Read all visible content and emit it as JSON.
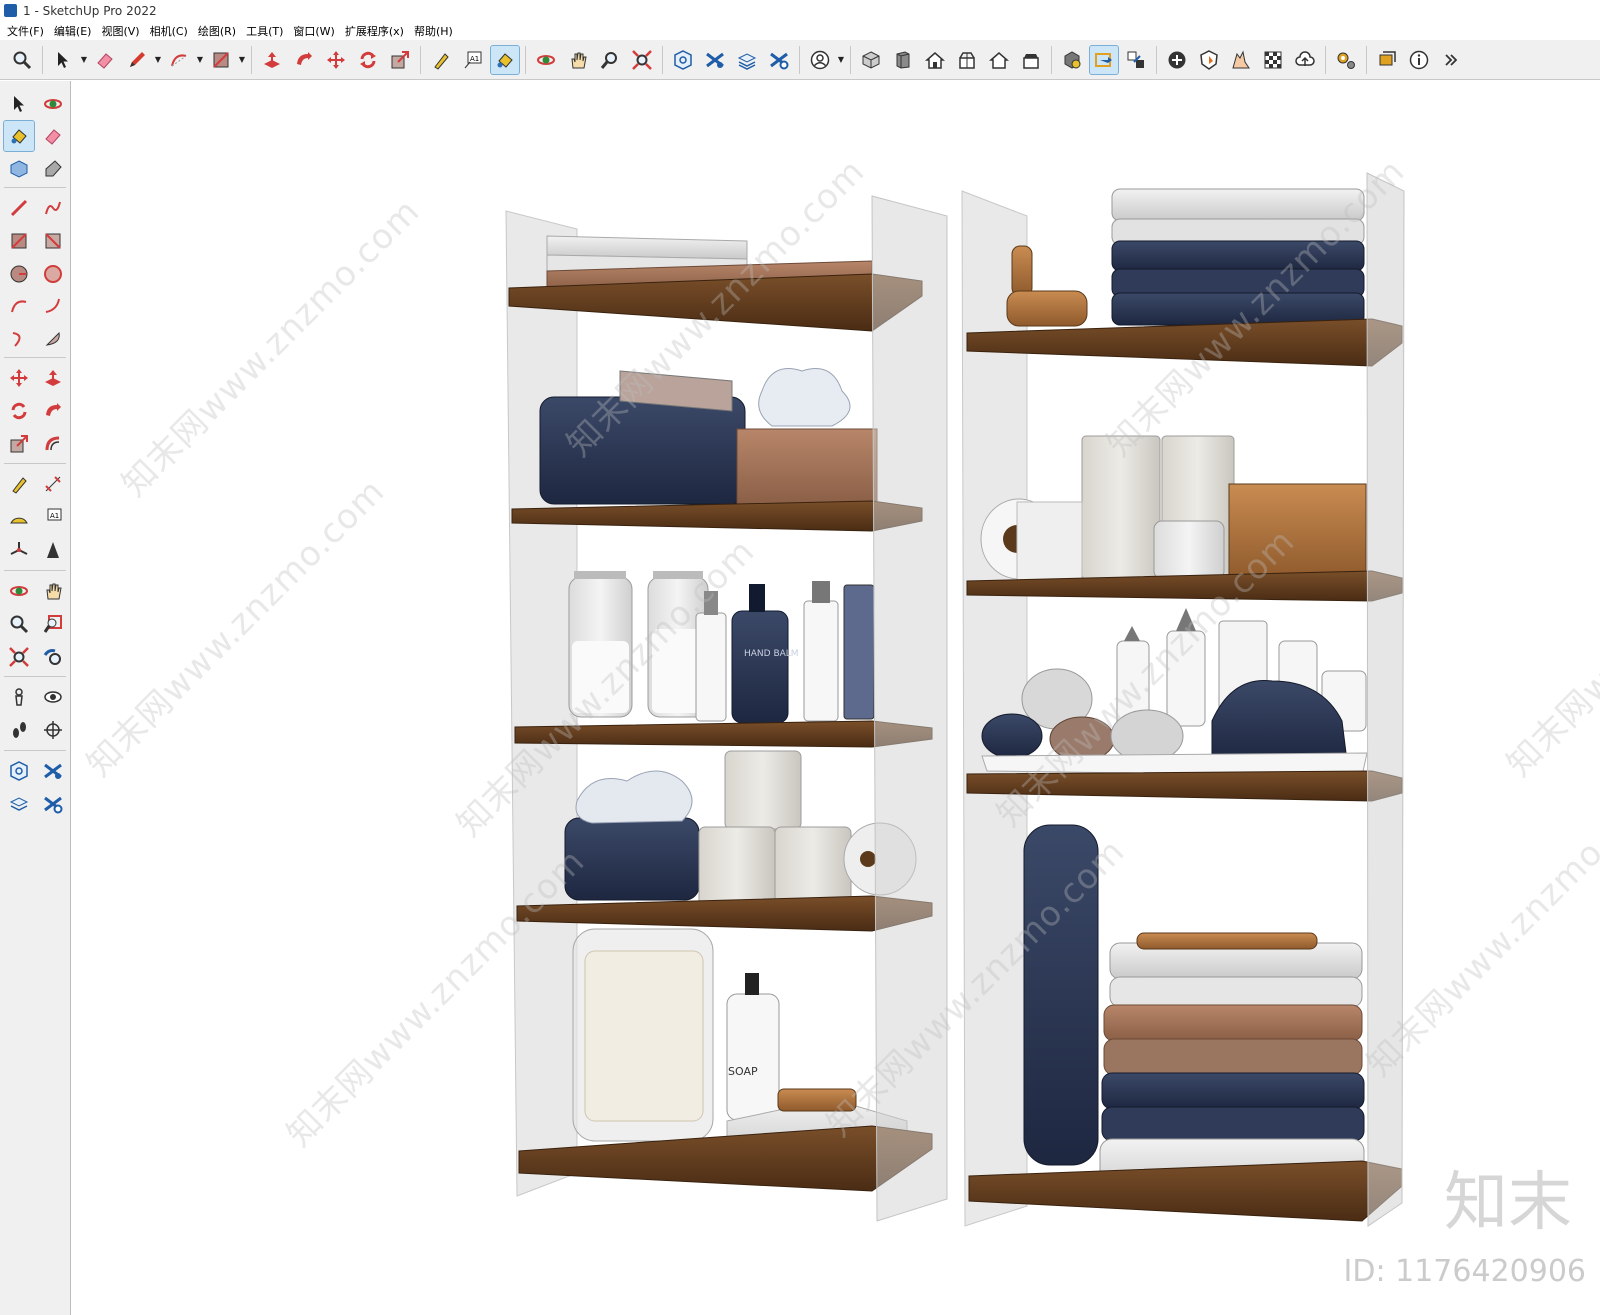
{
  "window": {
    "title": "1 - SketchUp Pro 2022"
  },
  "menu": [
    "文件(F)",
    "编辑(E)",
    "视图(V)",
    "相机(C)",
    "绘图(R)",
    "工具(T)",
    "窗口(W)",
    "扩展程序(x)",
    "帮助(H)"
  ],
  "toolbar": {
    "icons": [
      "zoom-icon",
      "select-icon",
      "eraser-icon",
      "pencil-icon",
      "arc-icon",
      "rectangle-icon",
      "push-pull-icon",
      "follow-me-icon",
      "move-icon",
      "rotate-icon",
      "scale-icon",
      "tape-measure-icon",
      "text-icon",
      "paint-bucket-icon",
      "orbit-icon",
      "pan-icon",
      "zoom-window-icon",
      "zoom-extents-icon",
      "3d-warehouse-icon",
      "extension-warehouse-icon",
      "layout-icon",
      "extension-manager-icon",
      "user-icon",
      "iso-view-icon",
      "top-view-icon",
      "front-view-icon",
      "right-view-icon",
      "back-view-icon",
      "left-view-icon",
      "solid-tools-icon",
      "outer-shell-icon",
      "intersect-icon",
      "add-location-icon",
      "shadows-icon",
      "sandbox-icon",
      "terrain-icon",
      "cloud-icon",
      "extensions-icon",
      "section-icon",
      "info-icon",
      "more-icon"
    ]
  },
  "leftbar": {
    "rows": [
      [
        "select-icon",
        "orbit-icon"
      ],
      [
        "paint-bucket-icon",
        "eraser-icon"
      ],
      [
        "component-icon",
        "tag-icon"
      ],
      [
        "line-icon",
        "freehand-icon"
      ],
      [
        "rectangle-icon",
        "rotated-rectangle-icon"
      ],
      [
        "circle-icon",
        "polygon-icon"
      ],
      [
        "arc-icon",
        "two-point-arc-icon"
      ],
      [
        "three-point-arc-icon",
        "pie-icon"
      ],
      [
        "move-icon",
        "push-pull-icon"
      ],
      [
        "rotate-icon",
        "follow-me-icon"
      ],
      [
        "scale-icon",
        "offset-icon"
      ],
      [
        "tape-measure-icon",
        "dimension-icon"
      ],
      [
        "protractor-icon",
        "text-icon"
      ],
      [
        "axes-icon",
        "3d-text-icon"
      ],
      [
        "orbit-icon",
        "pan-icon"
      ],
      [
        "zoom-icon",
        "zoom-window-icon"
      ],
      [
        "zoom-extents-icon",
        "previous-view-icon"
      ],
      [
        "position-camera-icon",
        "look-around-icon"
      ],
      [
        "walk-icon",
        "section-plane-icon"
      ],
      [
        "3d-warehouse-icon",
        "extension-warehouse-icon"
      ],
      [
        "layout-icon",
        "extension-manager-icon"
      ]
    ]
  },
  "watermark": {
    "text": "知末网www.znzmo.com",
    "brand": "知末",
    "id": "ID: 1176420906"
  },
  "scene": {
    "labels": {
      "hand_balm": "HAND BALM",
      "soap": "SOAP"
    }
  }
}
